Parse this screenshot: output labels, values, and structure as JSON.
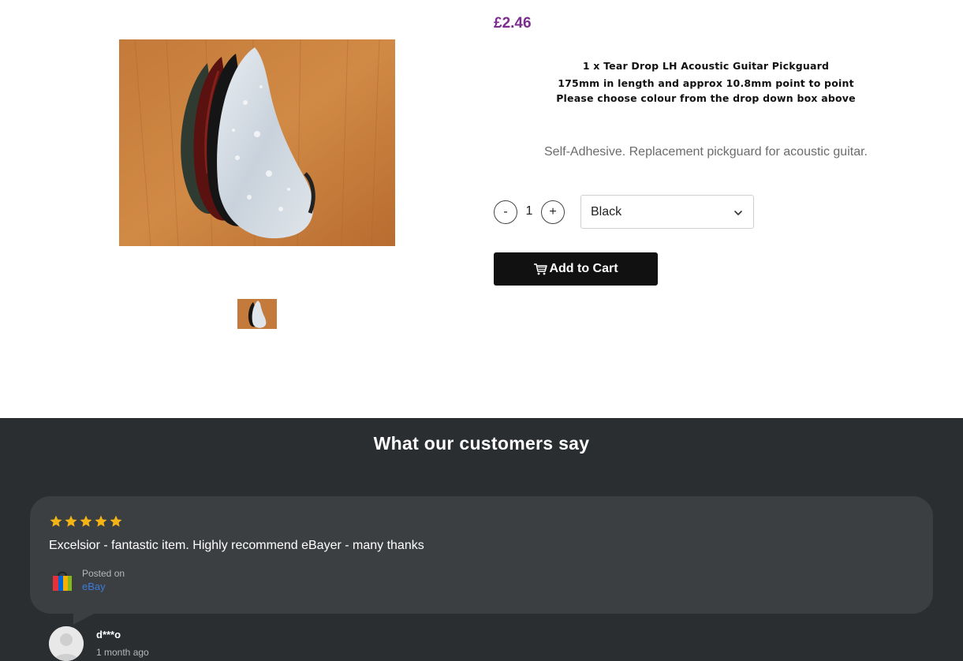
{
  "product": {
    "price": "£2.46",
    "description_lines": [
      "1 x Tear Drop LH Acoustic Guitar Pickguard",
      "175mm in length and approx 10.8mm point to point",
      "Please choose colour from the drop down box above"
    ],
    "subtitle": "Self-Adhesive. Replacement pickguard for acoustic guitar.",
    "quantity": {
      "minus_label": "-",
      "value": "1",
      "plus_label": "+"
    },
    "colour_select": {
      "selected": "Black",
      "icon": "chevron-down-icon"
    },
    "add_to_cart_label": "Add to Cart",
    "add_to_cart_icon": "shopping-cart-icon",
    "image_icon": "product-photo",
    "accent_color": "#7b2e8e"
  },
  "reviews": {
    "title": "What our customers say",
    "background_color": "#2a2e31",
    "items": [
      {
        "rating": 5,
        "rating_max": 5,
        "text": "Excelsior - fantastic item. Highly recommend eBayer - many thanks",
        "posted_on_label": "Posted on",
        "source": "eBay",
        "source_icon": "ebay-bag-icon",
        "reviewer": "d***o",
        "date": "1 month ago"
      }
    ]
  }
}
